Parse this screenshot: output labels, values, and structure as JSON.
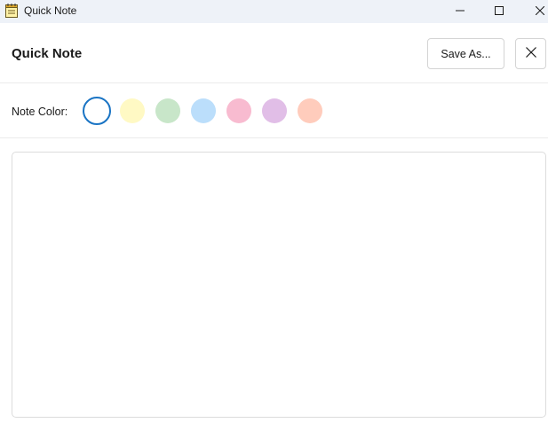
{
  "window": {
    "title": "Quick Note",
    "icon": "notepad-icon",
    "controls": [
      "minimize-icon",
      "maximize-icon",
      "close-icon"
    ]
  },
  "header": {
    "title": "Quick Note",
    "save_as_label": "Save As...",
    "close_icon": "close-icon"
  },
  "color_picker": {
    "label": "Note Color:",
    "selected_index": 0,
    "colors": [
      {
        "name": "white",
        "hex": "#ffffff"
      },
      {
        "name": "yellow",
        "hex": "#fff9c4"
      },
      {
        "name": "green",
        "hex": "#c8e6c9"
      },
      {
        "name": "blue",
        "hex": "#bbdefb"
      },
      {
        "name": "pink",
        "hex": "#f8bbd0"
      },
      {
        "name": "purple",
        "hex": "#e1bee7"
      },
      {
        "name": "orange",
        "hex": "#ffccbc"
      }
    ],
    "accent": "#1a74c4"
  },
  "editor": {
    "value": "",
    "placeholder": ""
  }
}
